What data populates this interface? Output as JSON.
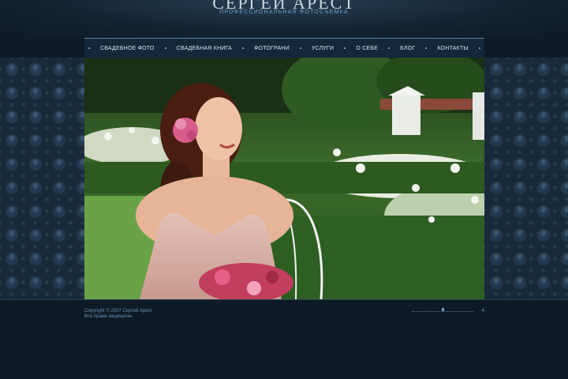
{
  "header": {
    "title": "СЕРГЕЙ АРЕСТ",
    "subtitle": "ПРОФЕССИОНАЛЬНАЯ ФОТОСЪЕМКА"
  },
  "nav": {
    "items": [
      {
        "label": "СВАДЕБНОЕ ФОТО"
      },
      {
        "label": "СВАДЕБНАЯ КНИГА"
      },
      {
        "label": "ФОТОГРАНИ"
      },
      {
        "label": "УСЛУГИ"
      },
      {
        "label": "О СЕБЕ"
      },
      {
        "label": "БЛОГ"
      },
      {
        "label": "КОНТАКТЫ"
      }
    ]
  },
  "gallery": {
    "current_page": "4"
  },
  "footer": {
    "copyright": "Copyright © 2007 Сергей Арест",
    "rights": "Все права защищены"
  },
  "colors": {
    "background": "#0e1a26",
    "nav_bg": "#13283a",
    "accent": "#6f9ec4"
  }
}
